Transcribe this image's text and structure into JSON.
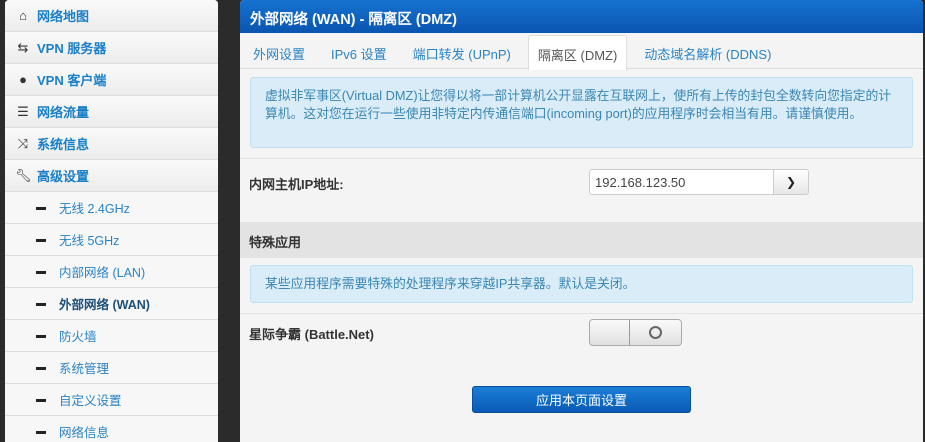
{
  "sidebar": {
    "items": [
      {
        "label": "网络地图",
        "icon": "home-icon"
      },
      {
        "label": "VPN 服务器",
        "icon": "retweet-icon"
      },
      {
        "label": "VPN 客户端",
        "icon": "globe-icon"
      },
      {
        "label": "网络流量",
        "icon": "list-icon"
      },
      {
        "label": "系统信息",
        "icon": "random-icon"
      },
      {
        "label": "高级设置",
        "icon": "wrench-icon"
      }
    ],
    "sub_items": [
      {
        "label": "无线 2.4GHz"
      },
      {
        "label": "无线 5GHz"
      },
      {
        "label": "内部网络 (LAN)"
      },
      {
        "label": "外部网络 (WAN)",
        "active": true
      },
      {
        "label": "防火墙"
      },
      {
        "label": "系统管理"
      },
      {
        "label": "自定义设置"
      },
      {
        "label": "网络信息"
      }
    ]
  },
  "header": {
    "title": "外部网络 (WAN) - 隔离区 (DMZ)"
  },
  "tabs": [
    {
      "label": "外网设置"
    },
    {
      "label": "IPv6 设置"
    },
    {
      "label": "端口转发 (UPnP)"
    },
    {
      "label": "隔离区 (DMZ)",
      "active": true
    },
    {
      "label": "动态域名解析 (DDNS)"
    }
  ],
  "dmz": {
    "description": "虚拟非军事区(Virtual DMZ)让您得以将一部计算机公开显露在互联网上，使所有上传的封包全数转向您指定的计算机。这对您在运行一些使用非特定内传通信端口(incoming port)的应用程序时会相当有用。请谨慎使用。",
    "host_ip_label": "内网主机IP地址:",
    "host_ip_value": "192.168.123.50"
  },
  "special": {
    "title": "特殊应用",
    "description": "某些应用程序需要特殊的处理程序来穿越IP共享器。默认是关闭。",
    "battlenet_label": "星际争霸 (Battle.Net)",
    "battlenet_enabled": false
  },
  "apply_label": "应用本页面设置",
  "colors": {
    "header": "#0a5ab6",
    "link": "#2a83c5",
    "alert_bg": "#d9ecf7"
  }
}
